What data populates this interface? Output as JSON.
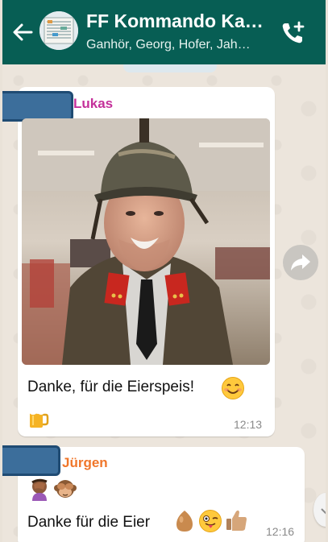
{
  "header": {
    "title": "FF Kommando Ka…",
    "subtitle": "Ganhör, Georg, Hofer, Jah…",
    "back_icon": "arrow-left-icon",
    "call_icon": "add-call-icon"
  },
  "messages": [
    {
      "sender": "Lukas",
      "sender_color": "#c4309a",
      "has_image": true,
      "text": "Danke, für die Eierspeis!",
      "emojis": [
        "smiling-face-icon",
        "beer-mug-icon"
      ],
      "time": "12:13"
    },
    {
      "sender": "Jürgen",
      "sender_color": "#f0762a",
      "emojis_top": [
        "facepalm-icon",
        "see-no-evil-monkey-icon"
      ],
      "text": "Danke für die Eier",
      "emojis": [
        "egg-icon",
        "winking-tongue-face-icon",
        "thumbs-up-icon"
      ],
      "time": "12:16"
    }
  ],
  "colors": {
    "header": "#075e54",
    "chat_background": "#ece5dc",
    "redaction": "#3c6e9b"
  }
}
